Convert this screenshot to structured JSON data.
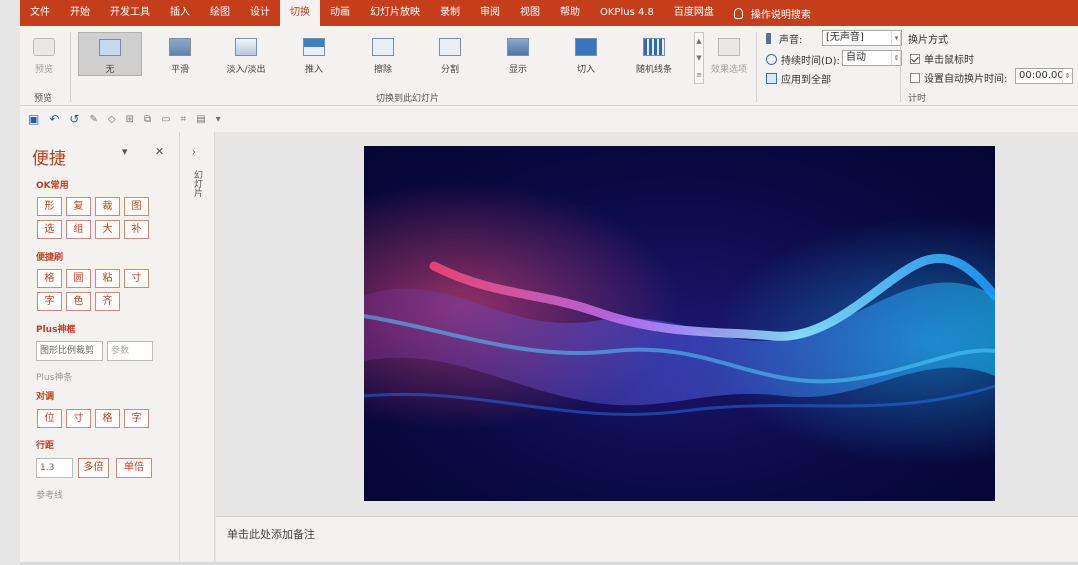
{
  "menu": {
    "items": [
      "文件",
      "开始",
      "开发工具",
      "插入",
      "绘图",
      "设计",
      "切换",
      "动画",
      "幻灯片放映",
      "录制",
      "审阅",
      "视图",
      "帮助",
      "OKPlus 4.8",
      "百度网盘"
    ],
    "active_index": 6,
    "search_label": "操作说明搜索"
  },
  "ribbon": {
    "preview_label": "预览",
    "preview_group_label": "预览",
    "transitions": [
      "无",
      "平滑",
      "淡入/淡出",
      "推入",
      "擦除",
      "分割",
      "显示",
      "切入",
      "随机线条"
    ],
    "effect_options_label": "效果选项",
    "transitions_group_label": "切换到此幻灯片",
    "sound_label": "声音:",
    "sound_value": "[无声音]",
    "duration_label": "持续时间(D):",
    "duration_value": "自动",
    "apply_all_label": "应用到全部",
    "advance_title": "换片方式",
    "on_click_label": "单击鼠标时",
    "after_label": "设置自动换片时间:",
    "after_value": "00:00.00",
    "timing_group_label": "计时"
  },
  "left_panel": {
    "title": "便捷",
    "section_ok": "OK常用",
    "ok_row1": [
      "形",
      "复",
      "裁",
      "图"
    ],
    "ok_row2": [
      "选",
      "组",
      "大",
      "补"
    ],
    "section_brush": "便捷刷",
    "brush_row1": [
      "格",
      "圆",
      "粘",
      "寸"
    ],
    "brush_row2": [
      "字",
      "色",
      "齐"
    ],
    "section_frame": "Plus神框",
    "frame_input": "图形比例裁剪",
    "frame_param": "参数",
    "section_bar": "Plus神条",
    "section_align": "对调",
    "align_row": [
      "位",
      "寸",
      "格",
      "字"
    ],
    "section_spacing": "行距",
    "spacing_value": "1.3",
    "spacing_multi": "多倍",
    "spacing_single": "单倍",
    "section_guides": "参考线"
  },
  "thumb_strip_label": "幻灯片",
  "notes_placeholder": "单击此处添加备注"
}
